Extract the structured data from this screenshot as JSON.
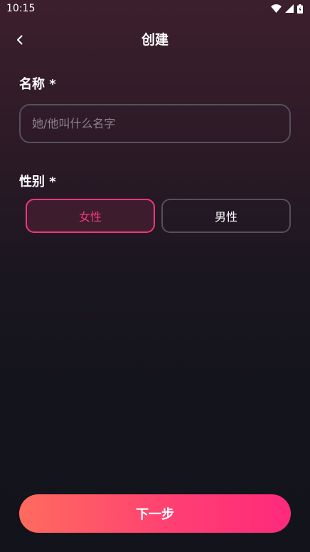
{
  "status_bar": {
    "time": "10:15"
  },
  "header": {
    "title": "创建"
  },
  "form": {
    "name_label": "名称 *",
    "name_placeholder": "她/他叫什么名字",
    "name_value": "",
    "gender_label": "性别 *",
    "gender_options": [
      "女性",
      "男性"
    ],
    "gender_selected": "女性"
  },
  "footer": {
    "next_label": "下一步"
  },
  "icons": {
    "back": "chevron-left-icon",
    "wifi": "wifi-icon",
    "signal": "signal-icon",
    "battery": "battery-icon"
  },
  "colors": {
    "accent": "#f0377a",
    "button_gradient_start": "#ff6b5e",
    "button_gradient_end": "#ff2a7a"
  }
}
